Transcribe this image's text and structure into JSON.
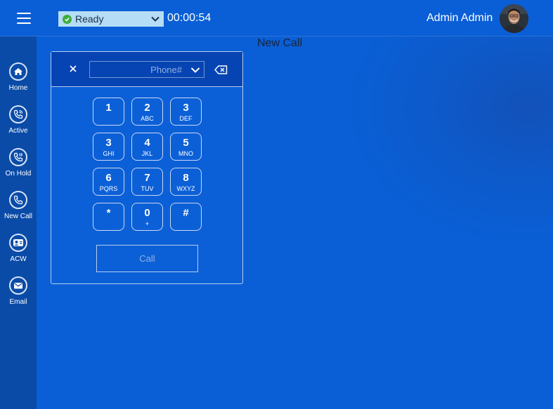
{
  "header": {
    "status_value": "Ready",
    "timer": "00:00:54",
    "user_name": "Admin Admin"
  },
  "sidebar": {
    "items": [
      {
        "label": "Home",
        "icon": "home-icon"
      },
      {
        "label": "Active",
        "icon": "active-call-icon"
      },
      {
        "label": "On Hold",
        "icon": "on-hold-icon"
      },
      {
        "label": "New Call",
        "icon": "phone-icon"
      },
      {
        "label": "ACW",
        "icon": "acw-icon"
      },
      {
        "label": "Email",
        "icon": "email-icon"
      }
    ]
  },
  "page": {
    "title": "New Call"
  },
  "dialpad": {
    "phone_placeholder": "Phone#",
    "phone_value": "",
    "keys": [
      {
        "digit": "1",
        "letters": ""
      },
      {
        "digit": "2",
        "letters": "ABC"
      },
      {
        "digit": "3",
        "letters": "DEF"
      },
      {
        "digit": "3",
        "letters": "GHI"
      },
      {
        "digit": "4",
        "letters": "JKL"
      },
      {
        "digit": "5",
        "letters": "MNO"
      },
      {
        "digit": "6",
        "letters": "PQRS"
      },
      {
        "digit": "7",
        "letters": "TUV"
      },
      {
        "digit": "8",
        "letters": "WXYZ"
      },
      {
        "digit": "*",
        "letters": ""
      },
      {
        "digit": "0",
        "letters": "+"
      },
      {
        "digit": "#",
        "letters": ""
      }
    ],
    "call_label": "Call"
  },
  "colors": {
    "background": "#0a5fd6",
    "sidebar": "#0a4ba8",
    "dialpad_header": "#0744b3",
    "status_bg": "#b5ddf5",
    "status_ok": "#3cae3a"
  }
}
